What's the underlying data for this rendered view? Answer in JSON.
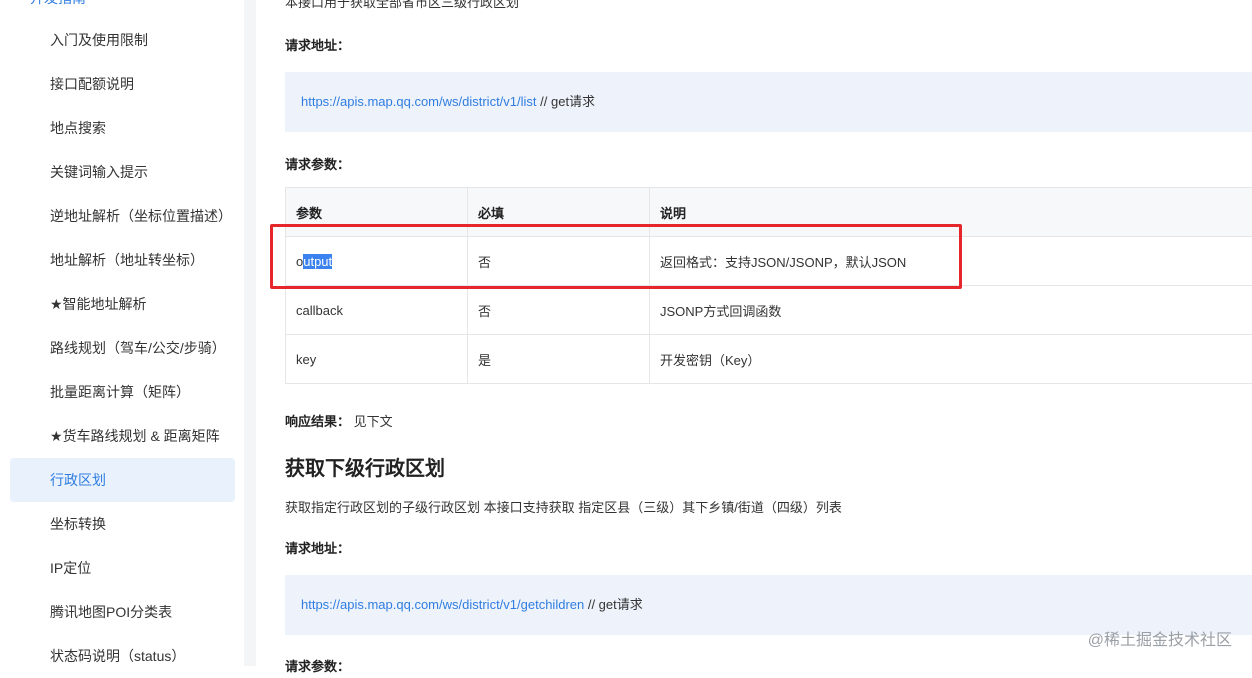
{
  "sidebar": {
    "section_partial": "开发指南",
    "items": [
      {
        "label": "入门及使用限制"
      },
      {
        "label": "接口配额说明"
      },
      {
        "label": "地点搜索"
      },
      {
        "label": "关键词输入提示"
      },
      {
        "label": "逆地址解析（坐标位置描述）"
      },
      {
        "label": "地址解析（地址转坐标）"
      },
      {
        "label": "★智能地址解析"
      },
      {
        "label": "路线规划（驾车/公交/步骑）"
      },
      {
        "label": "批量距离计算（矩阵）"
      },
      {
        "label": "★货车路线规划 & 距离矩阵"
      },
      {
        "label": "行政区划"
      },
      {
        "label": "坐标转换"
      },
      {
        "label": "IP定位"
      },
      {
        "label": "腾讯地图POI分类表"
      },
      {
        "label": "状态码说明（status）"
      }
    ]
  },
  "main": {
    "intro_partial": "本接口用于获取全部省市区三级行政区划",
    "request_url_label": "请求地址：",
    "url1": "https://apis.map.qq.com/ws/district/v1/list",
    "url1_comment": " // get请求",
    "params_label": "请求参数：",
    "table": {
      "headers": [
        "参数",
        "必填",
        "说明"
      ],
      "rows": [
        {
          "param_pre": "o",
          "param_sel": "utput",
          "required": "否",
          "desc": "返回格式：支持JSON/JSONP，默认JSON"
        },
        {
          "param": "callback",
          "required": "否",
          "desc": "JSONP方式回调函数"
        },
        {
          "param": "key",
          "required": "是",
          "desc": "开发密钥（Key）"
        }
      ]
    },
    "response_label": "响应结果：",
    "response_value": " 见下文",
    "section2_title": "获取下级行政区划",
    "section2_desc": "获取指定行政区划的子级行政区划 本接口支持获取 指定区县（三级）其下乡镇/街道（四级）列表",
    "request_url_label2": "请求地址：",
    "url2": "https://apis.map.qq.com/ws/district/v1/getchildren",
    "url2_comment": " // get请求",
    "params_label2_partial": "请求参数："
  },
  "watermark": "@稀土掘金技术社区",
  "colors": {
    "accent": "#2f7de1",
    "highlight_box": "#e5262b",
    "selection": "#3a82f0"
  }
}
